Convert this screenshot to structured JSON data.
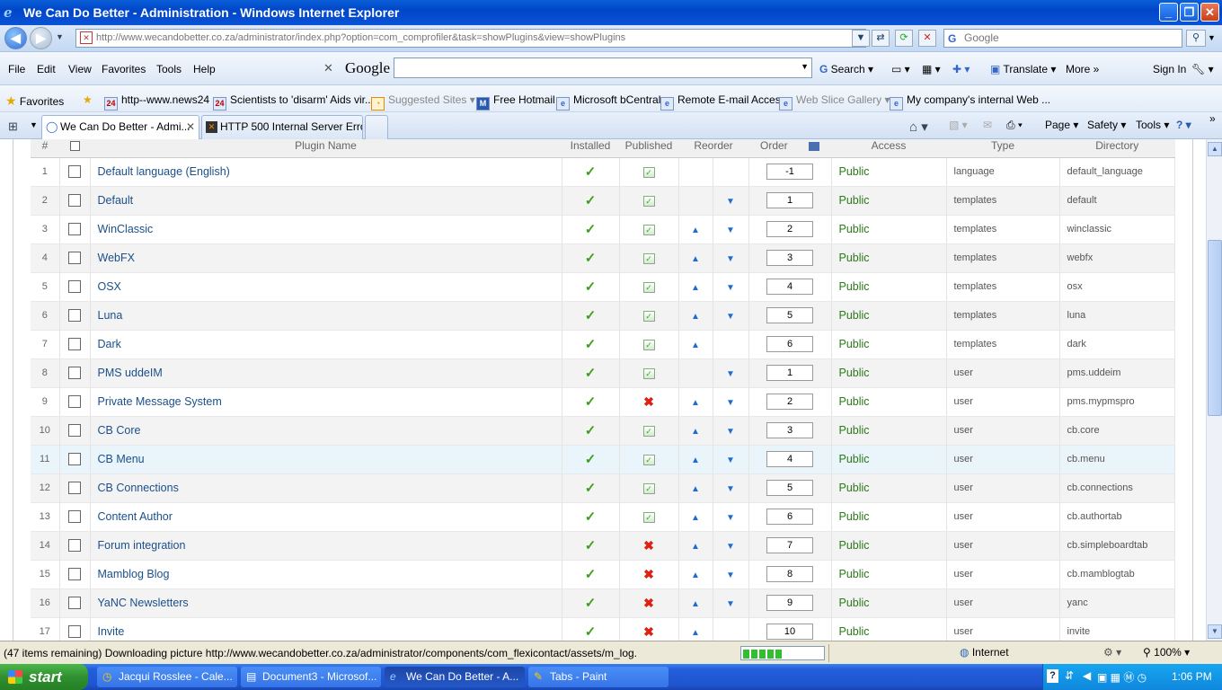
{
  "window": {
    "title": "We Can Do Better - Administration - Windows Internet Explorer"
  },
  "address": {
    "domain": "http://www.wecandobetter.co.za",
    "path": "/administrator/index.php?option=com_comprofiler&task=showPlugins&view=showPlugins",
    "search_placeholder": "Google"
  },
  "menu": [
    "File",
    "Edit",
    "View",
    "Favorites",
    "Tools",
    "Help"
  ],
  "google_toolbar": {
    "logo": "Google",
    "search": "Search",
    "translate": "Translate",
    "more": "More",
    "sign_in": "Sign In"
  },
  "favorites": {
    "label": "Favorites",
    "items": [
      "http--www.news24",
      "Scientists to 'disarm' Aids vir...",
      "Suggested Sites",
      "Free Hotmail",
      "Microsoft bCentral",
      "Remote E-mail Access",
      "Web Slice Gallery",
      "My company's internal Web ..."
    ]
  },
  "tabs": [
    {
      "label": "We Can Do Better - Admi...",
      "active": true
    },
    {
      "label": "HTTP 500 Internal Server Error",
      "active": false
    }
  ],
  "command_bar": {
    "page": "Page",
    "safety": "Safety",
    "tools": "Tools"
  },
  "table": {
    "headers": {
      "num": "#",
      "name": "Plugin Name",
      "installed": "Installed",
      "published": "Published",
      "reorder": "Reorder",
      "order": "Order",
      "access": "Access",
      "type": "Type",
      "directory": "Directory"
    },
    "rows": [
      {
        "n": "1",
        "name": "Default language (English)",
        "pub": true,
        "up": false,
        "down": false,
        "order": "-1",
        "access": "Public",
        "type": "language",
        "dir": "default_language"
      },
      {
        "n": "2",
        "name": "Default",
        "pub": true,
        "up": false,
        "down": true,
        "order": "1",
        "access": "Public",
        "type": "templates",
        "dir": "default"
      },
      {
        "n": "3",
        "name": "WinClassic",
        "pub": true,
        "up": true,
        "down": true,
        "order": "2",
        "access": "Public",
        "type": "templates",
        "dir": "winclassic"
      },
      {
        "n": "4",
        "name": "WebFX",
        "pub": true,
        "up": true,
        "down": true,
        "order": "3",
        "access": "Public",
        "type": "templates",
        "dir": "webfx"
      },
      {
        "n": "5",
        "name": "OSX",
        "pub": true,
        "up": true,
        "down": true,
        "order": "4",
        "access": "Public",
        "type": "templates",
        "dir": "osx"
      },
      {
        "n": "6",
        "name": "Luna",
        "pub": true,
        "up": true,
        "down": true,
        "order": "5",
        "access": "Public",
        "type": "templates",
        "dir": "luna"
      },
      {
        "n": "7",
        "name": "Dark",
        "pub": true,
        "up": true,
        "down": false,
        "order": "6",
        "access": "Public",
        "type": "templates",
        "dir": "dark"
      },
      {
        "n": "8",
        "name": "PMS uddeIM",
        "pub": true,
        "up": false,
        "down": true,
        "order": "1",
        "access": "Public",
        "type": "user",
        "dir": "pms.uddeim"
      },
      {
        "n": "9",
        "name": "Private Message System",
        "pub": false,
        "up": true,
        "down": true,
        "order": "2",
        "access": "Public",
        "type": "user",
        "dir": "pms.mypmspro"
      },
      {
        "n": "10",
        "name": "CB Core",
        "pub": true,
        "up": true,
        "down": true,
        "order": "3",
        "access": "Public",
        "type": "user",
        "dir": "cb.core"
      },
      {
        "n": "11",
        "name": "CB Menu",
        "pub": true,
        "up": true,
        "down": true,
        "order": "4",
        "access": "Public",
        "type": "user",
        "dir": "cb.menu"
      },
      {
        "n": "12",
        "name": "CB Connections",
        "pub": true,
        "up": true,
        "down": true,
        "order": "5",
        "access": "Public",
        "type": "user",
        "dir": "cb.connections"
      },
      {
        "n": "13",
        "name": "Content Author",
        "pub": true,
        "up": true,
        "down": true,
        "order": "6",
        "access": "Public",
        "type": "user",
        "dir": "cb.authortab"
      },
      {
        "n": "14",
        "name": "Forum integration",
        "pub": false,
        "up": true,
        "down": true,
        "order": "7",
        "access": "Public",
        "type": "user",
        "dir": "cb.simpleboardtab"
      },
      {
        "n": "15",
        "name": "Mamblog Blog",
        "pub": false,
        "up": true,
        "down": true,
        "order": "8",
        "access": "Public",
        "type": "user",
        "dir": "cb.mamblogtab"
      },
      {
        "n": "16",
        "name": "YaNC Newsletters",
        "pub": false,
        "up": true,
        "down": true,
        "order": "9",
        "access": "Public",
        "type": "user",
        "dir": "yanc"
      },
      {
        "n": "17",
        "name": "Invite",
        "pub": false,
        "up": true,
        "down": false,
        "order": "10",
        "access": "Public",
        "type": "user",
        "dir": "invite"
      }
    ]
  },
  "status": {
    "text": "(47 items remaining) Downloading picture http://www.wecandobetter.co.za/administrator/components/com_flexicontact/assets/m_log.",
    "zone": "Internet",
    "zoom": "100%"
  },
  "taskbar": {
    "start": "start",
    "tasks": [
      {
        "label": "Jacqui Rosslee - Cale...",
        "active": false
      },
      {
        "label": "Document3 - Microsof...",
        "active": false
      },
      {
        "label": "We Can Do Better - A...",
        "active": true
      },
      {
        "label": "Tabs - Paint",
        "active": false
      }
    ],
    "clock": "1:06 PM"
  }
}
